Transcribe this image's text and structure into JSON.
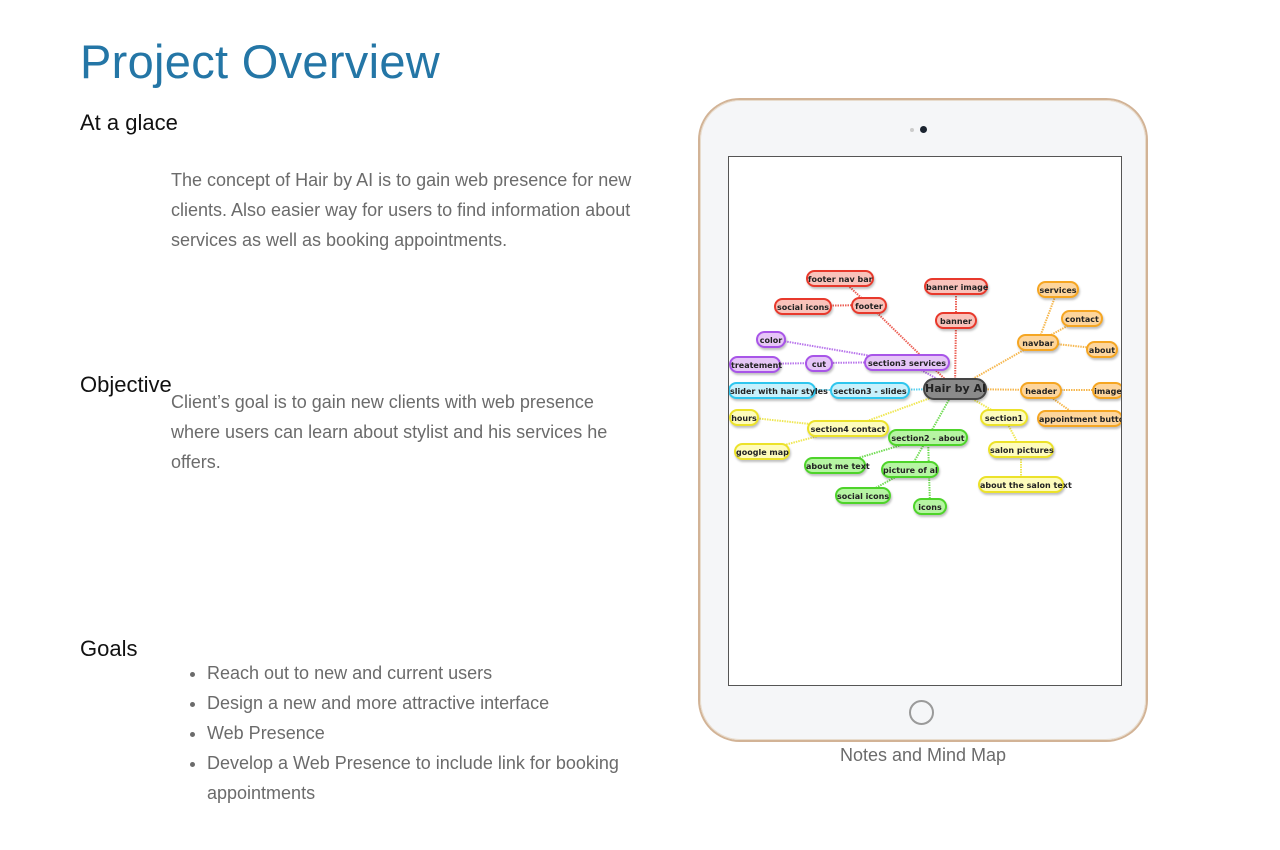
{
  "title": "Project Overview",
  "sections": {
    "glance": {
      "heading": "At a glace",
      "text": "The concept of Hair by AI is to gain web presence for new clients. Also easier way for users to find information about services as well as booking appointments."
    },
    "objective": {
      "heading": "Objective",
      "text": "Client’s goal is to gain new clients with web presence where users can learn about stylist and his services he offers."
    },
    "goals": {
      "heading": "Goals",
      "items": [
        "Reach out to new and current users",
        "Design a new and more attractive interface",
        "Web Presence",
        "Develop a Web Presence to include link for booking appointments"
      ]
    }
  },
  "device": {
    "caption": "Notes and Mind Map",
    "mindmap": {
      "colors": {
        "gray": {
          "fill": "#8a8a8a",
          "border": "#444444"
        },
        "red": {
          "fill": "#f9c3bb",
          "border": "#e8392c"
        },
        "orange": {
          "fill": "#fdd59c",
          "border": "#f5a623"
        },
        "purple": {
          "fill": "#e6c6f7",
          "border": "#a855e8"
        },
        "cyan": {
          "fill": "#c8f1fc",
          "border": "#2fc6ee"
        },
        "yellow": {
          "fill": "#fefcbc",
          "border": "#ece22a"
        },
        "green": {
          "fill": "#b6f5a3",
          "border": "#4ed42a"
        }
      },
      "nodes": [
        {
          "label": "Hair by AI",
          "color": "gray"
        },
        {
          "label": "footer nav bar",
          "color": "red"
        },
        {
          "label": "social icons",
          "color": "red"
        },
        {
          "label": "footer",
          "color": "red"
        },
        {
          "label": "banner image",
          "color": "red"
        },
        {
          "label": "banner",
          "color": "red"
        },
        {
          "label": "services",
          "color": "orange"
        },
        {
          "label": "contact",
          "color": "orange"
        },
        {
          "label": "navbar",
          "color": "orange"
        },
        {
          "label": "about",
          "color": "orange"
        },
        {
          "label": "color",
          "color": "purple"
        },
        {
          "label": "treatement",
          "color": "purple"
        },
        {
          "label": "cut",
          "color": "purple"
        },
        {
          "label": "section3 services",
          "color": "purple"
        },
        {
          "label": "slider with hair styles",
          "color": "cyan"
        },
        {
          "label": "section3 - slides",
          "color": "cyan"
        },
        {
          "label": "header",
          "color": "orange"
        },
        {
          "label": "image",
          "color": "orange"
        },
        {
          "label": "appointment button",
          "color": "orange"
        },
        {
          "label": "section1",
          "color": "yellow"
        },
        {
          "label": "hours",
          "color": "yellow"
        },
        {
          "label": "section4 contact",
          "color": "yellow"
        },
        {
          "label": "section2 - about",
          "color": "green"
        },
        {
          "label": "google map",
          "color": "yellow"
        },
        {
          "label": "salon pictures",
          "color": "yellow"
        },
        {
          "label": "about me text",
          "color": "green"
        },
        {
          "label": "picture of al",
          "color": "green"
        },
        {
          "label": "social icons",
          "color": "green"
        },
        {
          "label": "about the salon text",
          "color": "yellow"
        },
        {
          "label": "icons",
          "color": "green"
        }
      ]
    }
  }
}
